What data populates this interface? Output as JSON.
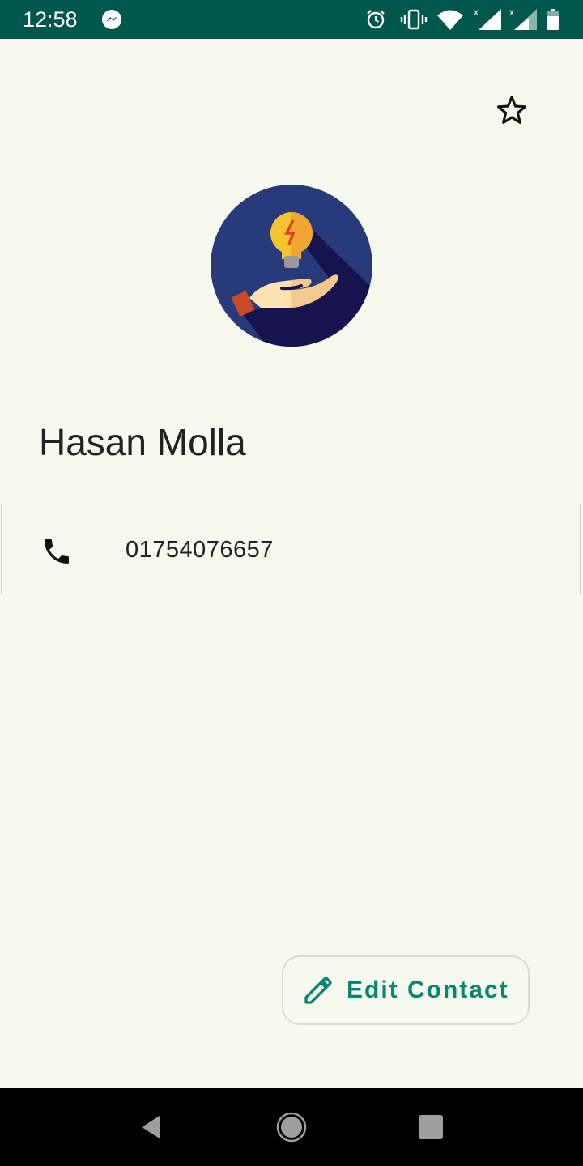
{
  "status_bar": {
    "time": "12:58",
    "icons": [
      "messenger-icon",
      "alarm-icon",
      "vibrate-icon",
      "wifi-icon",
      "signal-icon",
      "signal-icon",
      "battery-icon"
    ],
    "background_color": "#00574b"
  },
  "header": {
    "favorite_icon": "star-outline-icon"
  },
  "contact": {
    "avatar_icon": "idea-hand-icon",
    "name": "Hasan Molla",
    "phone": "01754076657",
    "phone_icon": "phone-icon"
  },
  "actions": {
    "edit_label": "Edit Contact",
    "edit_icon": "pencil-icon",
    "accent_color": "#078572"
  },
  "nav_bar": {
    "buttons": [
      "back-icon",
      "home-icon",
      "recents-icon"
    ]
  }
}
